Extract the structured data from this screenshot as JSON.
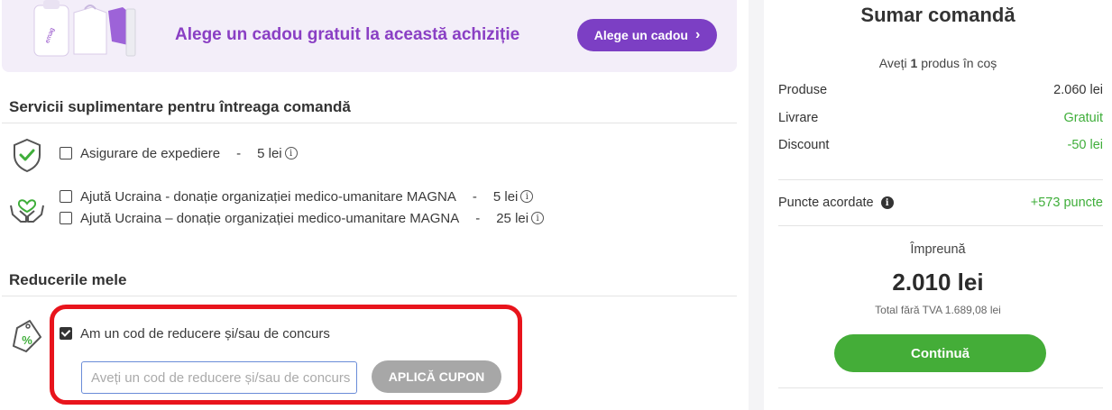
{
  "gift_banner": {
    "text": "Alege un cadou gratuit la această achiziție",
    "button_label": "Alege un cadou",
    "button_icon": "chevron-right-icon"
  },
  "services": {
    "title": "Servicii suplimentare pentru întreaga comandă",
    "options": [
      {
        "label": "Asigurare de expediere",
        "sep": "-",
        "price": "5 lei",
        "checked": false
      },
      {
        "label": "Ajută Ucraina - donație organizației medico-umanitare MAGNA",
        "sep": "-",
        "price": "5 lei",
        "checked": false
      },
      {
        "label": "Ajută Ucraina – donație organizației medico-umanitare MAGNA",
        "sep": "-",
        "price": "25 lei",
        "checked": false
      }
    ],
    "info_icon_char": "i"
  },
  "discounts": {
    "title": "Reducerile mele",
    "checkbox_label": "Am un cod de reducere și/sau de concurs",
    "checkbox_checked": true,
    "input_placeholder": "Aveți un cod de reducere și/sau de concurs",
    "input_value": "",
    "apply_button": "APLICĂ CUPON"
  },
  "summary": {
    "title": "Sumar comandă",
    "cart_prefix": "Aveți ",
    "cart_count": "1",
    "cart_suffix": " produs în coș",
    "rows": [
      {
        "label": "Produse",
        "value": "2.060 lei"
      },
      {
        "label": "Livrare",
        "value": "Gratuit"
      },
      {
        "label": "Discount",
        "value": "-50 lei"
      }
    ],
    "points_label": "Puncte acordate",
    "points_value": "+573 puncte",
    "together_label": "Împreună",
    "total": "2.010 lei",
    "vat_note": "Total fără TVA 1.689,08 lei",
    "continue_button": "Continuă"
  },
  "colors": {
    "purple": "#7c3fc4",
    "green": "#3fae3a",
    "highlight_red": "#e8141c"
  }
}
